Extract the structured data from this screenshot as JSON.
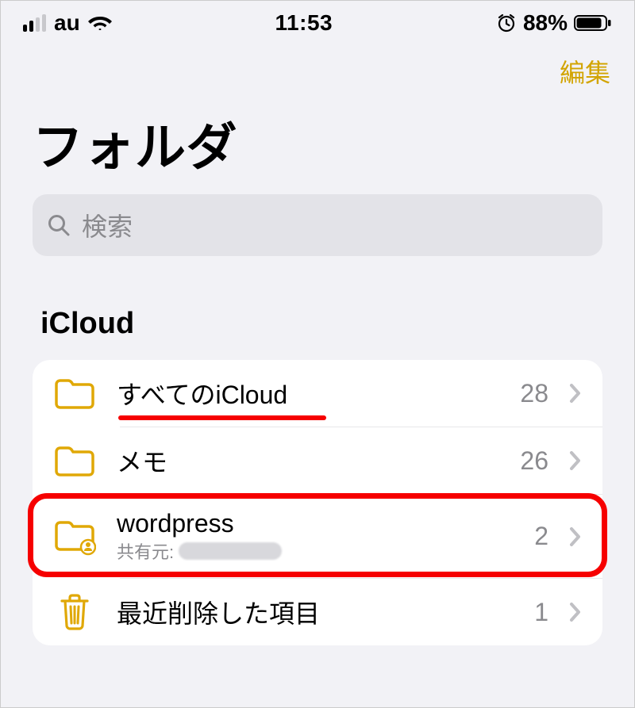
{
  "statusBar": {
    "carrier": "au",
    "time": "11:53",
    "batteryPercent": "88%"
  },
  "navBar": {
    "editLabel": "編集"
  },
  "pageTitle": "フォルダ",
  "search": {
    "placeholder": "検索"
  },
  "sectionHeader": "iCloud",
  "folders": [
    {
      "name": "すべてのiCloud",
      "count": "28",
      "icon": "folder",
      "shared": false,
      "subtitle": null
    },
    {
      "name": "メモ",
      "count": "26",
      "icon": "folder",
      "shared": false,
      "subtitle": null
    },
    {
      "name": "wordpress",
      "count": "2",
      "icon": "shared-folder",
      "shared": true,
      "subtitle": "共有元:"
    },
    {
      "name": "最近削除した項目",
      "count": "1",
      "icon": "trash",
      "shared": false,
      "subtitle": null
    }
  ],
  "colors": {
    "accent": "#d2a400",
    "folderIcon": "#e0a806",
    "annotation": "#f60000"
  }
}
